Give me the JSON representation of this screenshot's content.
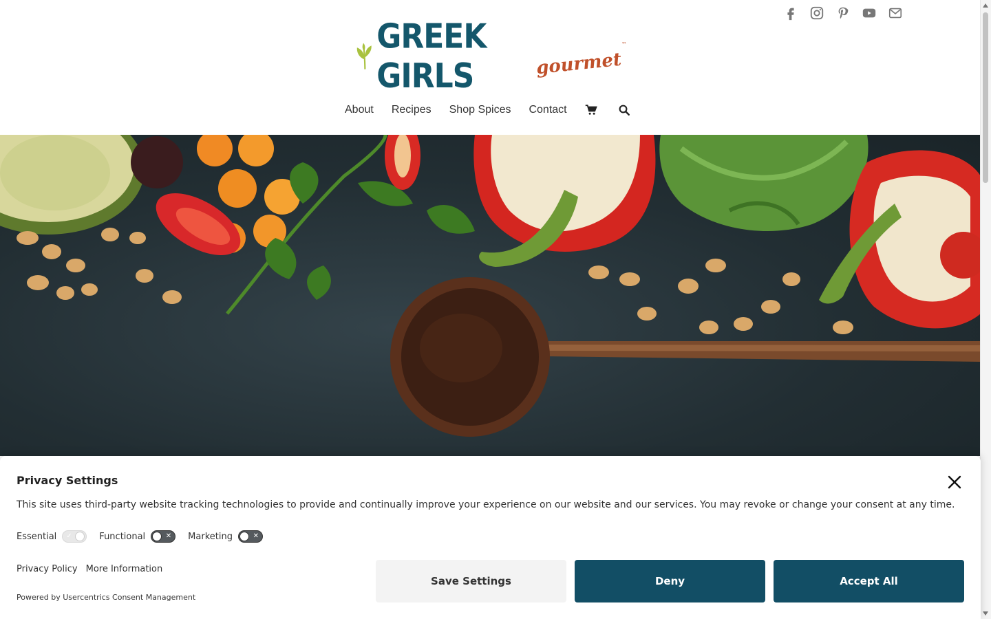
{
  "header": {
    "social_icons": [
      "facebook-icon",
      "instagram-icon",
      "pinterest-icon",
      "youtube-icon",
      "email-icon"
    ],
    "logo": {
      "text_main": "GREEK GIRLS",
      "text_sub": "gourmet",
      "trademark": "™",
      "colors": {
        "main": "#14576b",
        "sub": "#c0502a",
        "leaf": "#a9c23f"
      }
    },
    "nav": {
      "items": [
        "About",
        "Recipes",
        "Shop Spices",
        "Contact"
      ],
      "icons": [
        "cart-icon",
        "search-icon"
      ]
    }
  },
  "hero": {
    "description_image": "vegetables-and-wooden-spoon",
    "background_color": "#28363b"
  },
  "consent": {
    "title": "Privacy Settings",
    "description": "This site uses third-party website tracking technologies to provide and continually improve your experience on our website and our services. You may revoke or change your consent at any time.",
    "toggles": [
      {
        "label": "Essential",
        "state": "on-disabled"
      },
      {
        "label": "Functional",
        "state": "off"
      },
      {
        "label": "Marketing",
        "state": "off"
      }
    ],
    "links": [
      "Privacy Policy",
      "More Information"
    ],
    "powered_by": "Powered by Usercentrics Consent Management",
    "buttons": {
      "save": "Save Settings",
      "deny": "Deny",
      "accept": "Accept All"
    },
    "colors": {
      "primary": "#124e65",
      "secondary_bg": "#f3f3f3"
    }
  }
}
